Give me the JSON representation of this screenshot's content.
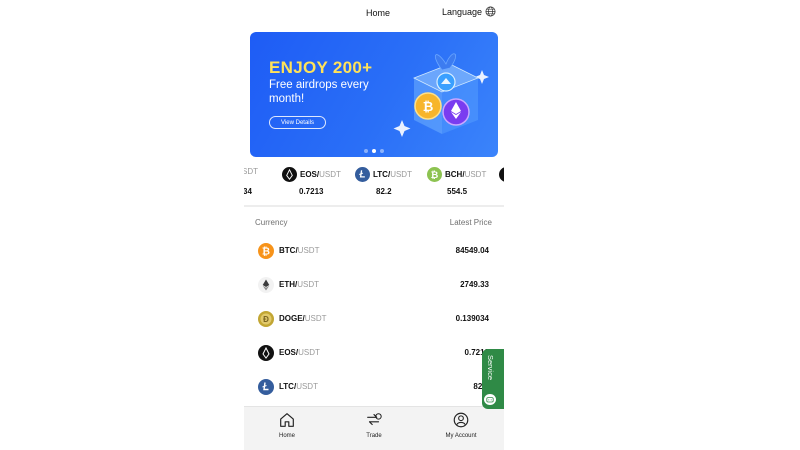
{
  "header": {
    "title": "Home",
    "language_label": "Language",
    "language_icon": "globe-icon"
  },
  "banner": {
    "headline": "ENJOY 200+",
    "subtitle": "Free airdrops every month!",
    "button_label": "View Details",
    "slide_count": 3,
    "active_slide": 2,
    "background_color": "#2a6ff7",
    "headline_color": "#ffe259"
  },
  "ticker": [
    {
      "base": "",
      "quote": "/USDT",
      "price": "34",
      "icon": "partial"
    },
    {
      "base": "EOS/",
      "quote": "USDT",
      "price": "0.7213",
      "icon": "eos-coin-icon"
    },
    {
      "base": "LTC/",
      "quote": "USDT",
      "price": "82.2",
      "icon": "ltc-coin-icon"
    },
    {
      "base": "BCH/",
      "quote": "USDT",
      "price": "554.5",
      "icon": "bch-coin-icon"
    }
  ],
  "list": {
    "header_currency": "Currency",
    "header_price": "Latest Price",
    "rows": [
      {
        "base": "BTC/",
        "quote": "USDT",
        "price": "84549.04",
        "icon": "btc-coin-icon"
      },
      {
        "base": "ETH/",
        "quote": "USDT",
        "price": "2749.33",
        "icon": "eth-coin-icon"
      },
      {
        "base": "DOGE/",
        "quote": "USDT",
        "price": "0.139034",
        "icon": "doge-coin-icon"
      },
      {
        "base": "EOS/",
        "quote": "USDT",
        "price": "0.7213",
        "icon": "eos-coin-icon"
      },
      {
        "base": "LTC/",
        "quote": "USDT",
        "price": "82.2",
        "icon": "ltc-coin-icon"
      }
    ]
  },
  "service": {
    "label": "Service",
    "color": "#2f8a46",
    "icon": "chat-icon"
  },
  "nav": [
    {
      "label": "Home",
      "icon": "home-icon"
    },
    {
      "label": "Trade",
      "icon": "trade-icon"
    },
    {
      "label": "My Account",
      "icon": "user-icon"
    }
  ],
  "colors": {
    "btc": "#f7931a",
    "eth": "#f2f2f2",
    "doge": "#c2a633",
    "eos": "#111111",
    "ltc": "#345d9d",
    "bch": "#8dc351",
    "accent": "#2a6ff7"
  }
}
